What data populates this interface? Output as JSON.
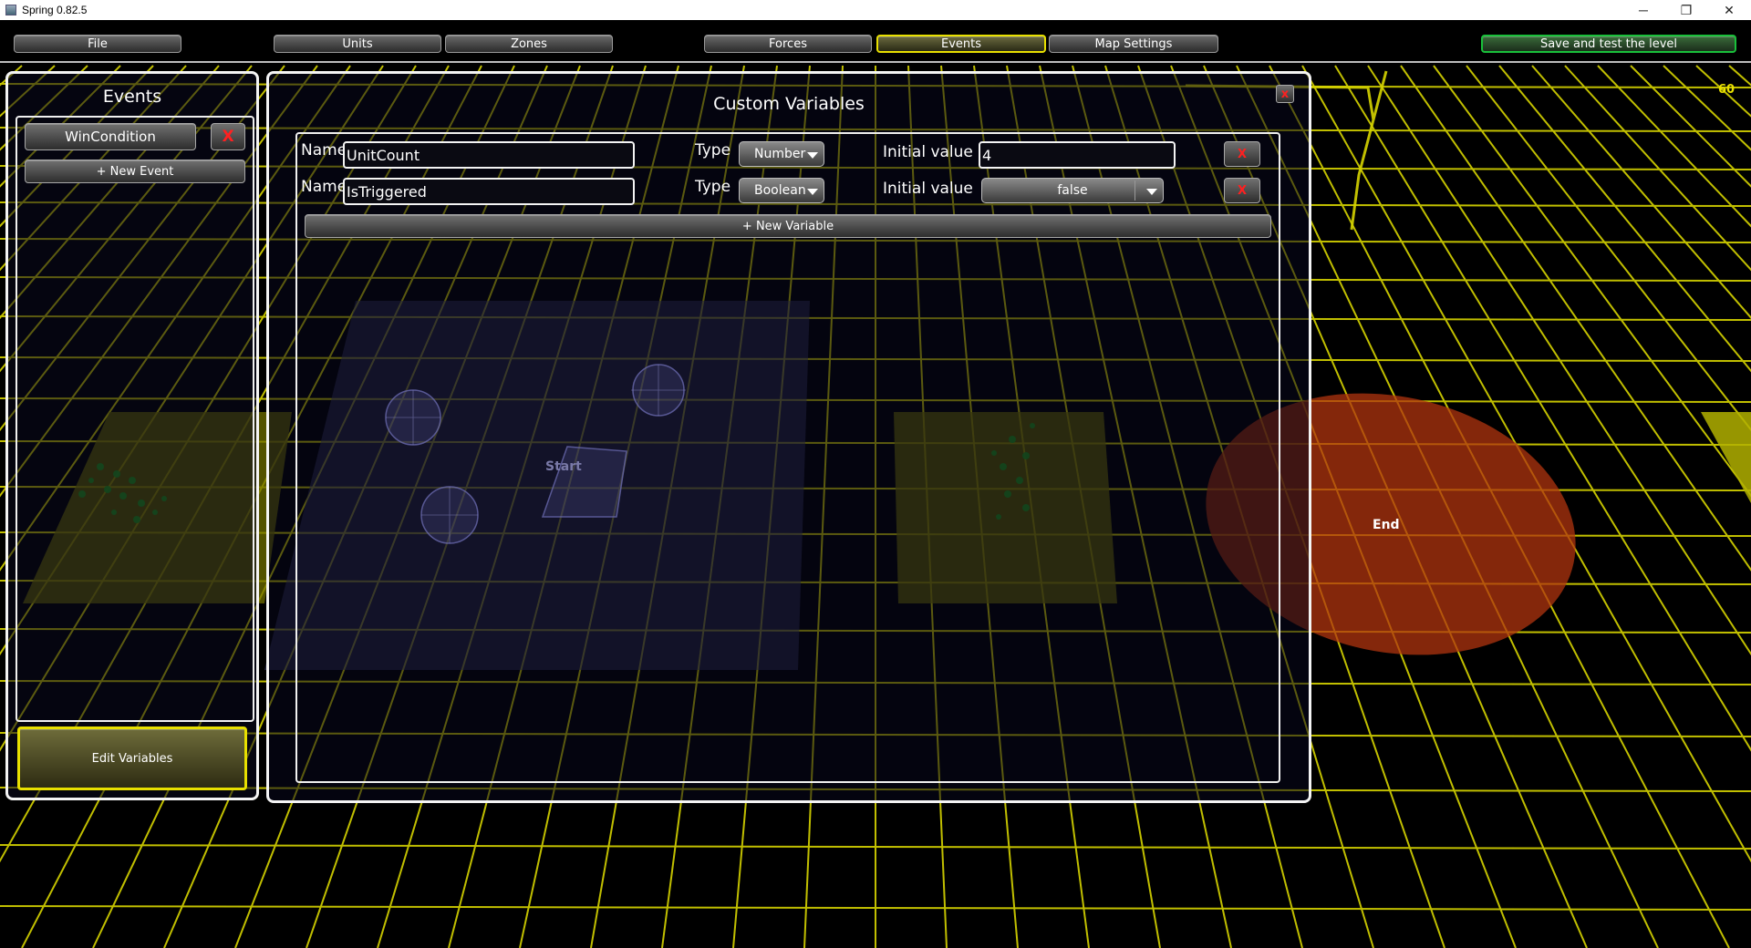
{
  "window": {
    "title": "Spring 0.82.5",
    "controls": {
      "minimize": "─",
      "restore": "❐",
      "close": "✕"
    }
  },
  "toolbar": {
    "file": "File",
    "units": "Units",
    "zones": "Zones",
    "forces": "Forces",
    "events": "Events",
    "map_settings": "Map Settings",
    "save_test": "Save and test the level"
  },
  "fps": "60",
  "events_panel": {
    "title": "Events",
    "items": [
      {
        "label": "WinCondition",
        "delete": "X"
      }
    ],
    "new_event": "+ New Event",
    "edit_variables": "Edit Variables"
  },
  "variables_panel": {
    "title": "Custom Variables",
    "close": "x",
    "name_label": "Name",
    "type_label": "Type",
    "initial_label": "Initial value",
    "variables": [
      {
        "name": "UnitCount",
        "type": "Number",
        "initial": "4",
        "delete": "X"
      },
      {
        "name": "IsTriggered",
        "type": "Boolean",
        "initial": "false",
        "delete": "X"
      }
    ],
    "new_variable": "+ New Variable"
  },
  "scene": {
    "start_label": "Start",
    "end_label": "End"
  },
  "colors": {
    "grid": "#d6d400",
    "active_tab": "#e8e000",
    "save_button": "#19c03a",
    "end_zone": "#b0340f",
    "start_zone": "#3a3a66"
  }
}
